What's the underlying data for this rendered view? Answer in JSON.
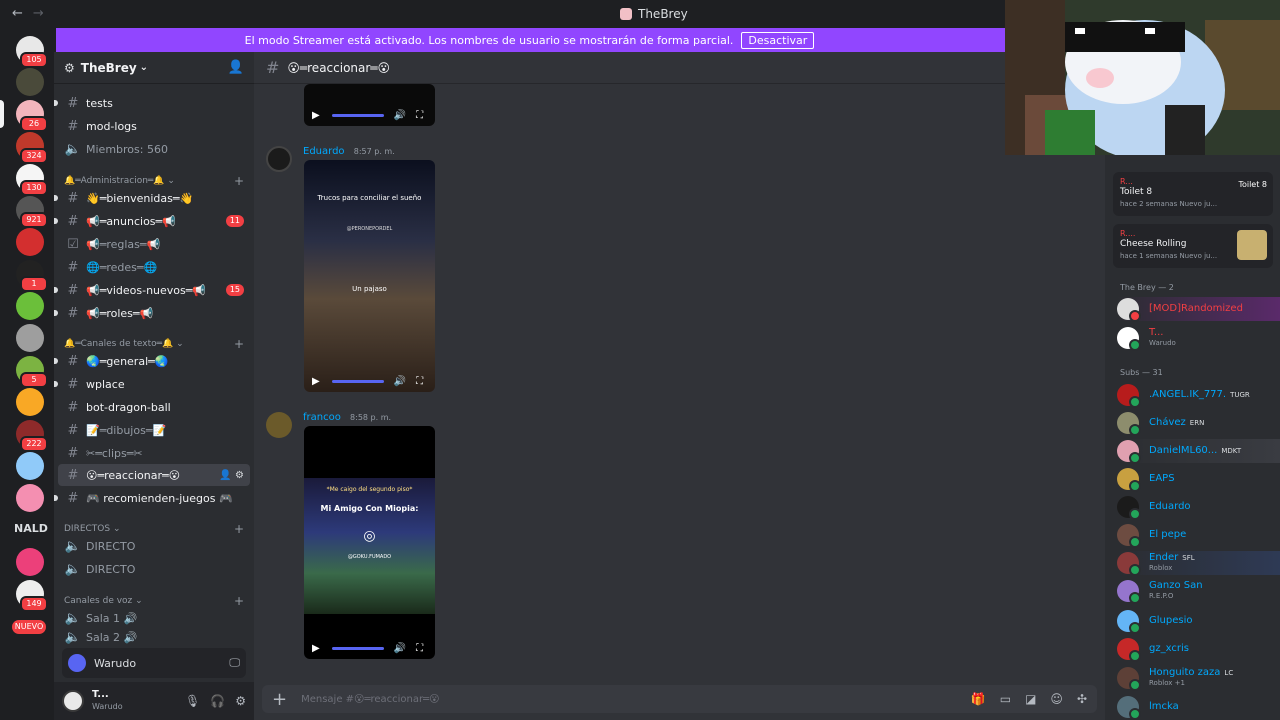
{
  "window": {
    "title": "TheBrey",
    "back": "←",
    "forward": "→"
  },
  "banner": {
    "text": "El modo Streamer está activado. Los nombres de usuario se mostrarán de forma parcial.",
    "button": "Desactivar"
  },
  "rail": {
    "badges": [
      "105",
      "26",
      "324",
      "130",
      "921",
      "1",
      "5",
      "222",
      "149"
    ],
    "nald": "NALD",
    "nuevo": "NUEVO"
  },
  "server": {
    "name": "TheBrey"
  },
  "channels": [
    {
      "name": "tests"
    },
    {
      "name": "mod-logs"
    },
    {
      "name": "Miembros: 560"
    }
  ],
  "categories": {
    "admin": "🔔═Administracion═🔔",
    "text": "🔔═Canales de texto═🔔",
    "directos": "DIRECTOS",
    "voz": "Canales de voz"
  },
  "admin_channels": [
    {
      "name": "👋═bienvenidas═👋"
    },
    {
      "name": "📢═anuncios═📢",
      "mentions": "11"
    },
    {
      "name": "📢═reglas═📢"
    },
    {
      "name": "🌐═redes═🌐"
    },
    {
      "name": "📢═videos-nuevos═📢",
      "mentions": "15"
    },
    {
      "name": "📢═roles═📢"
    }
  ],
  "text_channels": [
    {
      "name": "🌏═general═🌏"
    },
    {
      "name": "wplace"
    },
    {
      "name": "bot-dragon-ball"
    },
    {
      "name": "📝═dibujos═📝"
    },
    {
      "name": "✂═clips═✂"
    },
    {
      "name": "😮═reaccionar═😮"
    },
    {
      "name": "🎮 recomienden-juegos 🎮"
    }
  ],
  "directos": [
    {
      "name": "DIRECTO"
    },
    {
      "name": "DIRECTO"
    }
  ],
  "voice": [
    {
      "name": "Sala 1 🔊"
    },
    {
      "name": "Sala 2 🔊"
    }
  ],
  "activity_box": {
    "label": "Warudo"
  },
  "user": {
    "name": "T...",
    "status": "Warudo"
  },
  "chat": {
    "channel": "😮═reaccionar═😮",
    "messages": [
      {
        "author": "Eduardo",
        "time": "8:57 p. m.",
        "video_caption": "Trucos para conciliar el sueño",
        "video_handle": "@PERONEPORDEL",
        "video_sub": "Un pajaso"
      },
      {
        "author": "francoo",
        "time": "8:58 p. m.",
        "video_caption": "*Me caigo del segundo piso*",
        "video_title": "Mi Amigo Con Miopia:",
        "video_handle": "@GOKU.FUMADO"
      }
    ],
    "composer_placeholder": "Mensaje #😮═reaccionar═😮"
  },
  "activities": [
    {
      "line1": "R...",
      "line2": "Toilet 8",
      "line3": "hace 2 semanas   Nuevo ju...",
      "thumb": "Toilet 8"
    },
    {
      "line1": "R....",
      "line2": "Cheese Rolling",
      "line3": "hace 1 semanas   Nuevo ju..."
    }
  ],
  "sections": {
    "brey": "The Brey — 2",
    "subs": "Subs — 31"
  },
  "brey_members": [
    {
      "name": "[MOD]Randomized",
      "color": "#f23f43"
    },
    {
      "name": "T...",
      "sub": "Warudo",
      "color": "#f23f43"
    }
  ],
  "subs_members": [
    {
      "name": ".ANGEL.IK_777.",
      "tag": "TUGR"
    },
    {
      "name": "Chávez",
      "tag": "ERN"
    },
    {
      "name": "DanielML60...",
      "tag": "MDKT"
    },
    {
      "name": "EAPS"
    },
    {
      "name": "Eduardo"
    },
    {
      "name": "El pepe"
    },
    {
      "name": "Ender",
      "tag": "SFL",
      "sub": "Roblox"
    },
    {
      "name": "Ganzo San",
      "sub": "R.E.P.O"
    },
    {
      "name": "Glupesio"
    },
    {
      "name": "gz_xcris"
    },
    {
      "name": "Honguito zaza",
      "tag": "LC",
      "sub": "Roblox +1"
    },
    {
      "name": "lmcka"
    }
  ],
  "colors": {
    "accent": "#9146ff",
    "link": "#00a8fc",
    "danger": "#f23f43",
    "online": "#23a55a"
  }
}
